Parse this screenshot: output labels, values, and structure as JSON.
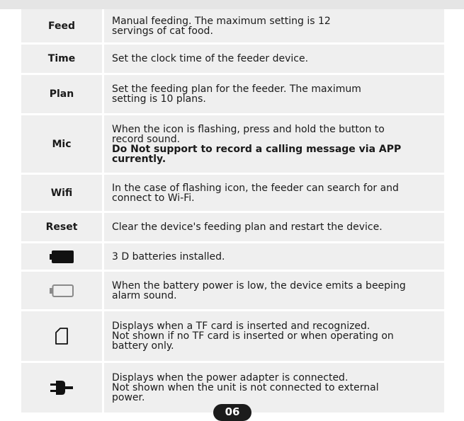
{
  "rows": [
    {
      "label": "Feed",
      "text": [
        "Manual feeding. The maximum setting is 12",
        "servings of cat food."
      ]
    },
    {
      "label": "Time",
      "text": [
        "Set the clock time of the feeder device."
      ]
    },
    {
      "label": "Plan",
      "text": [
        "Set the feeding plan for the feeder. The maximum",
        "setting is 10 plans."
      ]
    },
    {
      "label": "Mic",
      "text": [
        "When the icon is flashing, press and hold the button to",
        "record sound."
      ],
      "bold": [
        "Do Not support to record a calling message via APP",
        "currently."
      ]
    },
    {
      "label": "Wifi",
      "text": [
        "In the case of flashing icon, the feeder can search for and",
        "connect to Wi-Fi."
      ]
    },
    {
      "label": "Reset",
      "text": [
        "Clear the device's feeding plan and restart the device."
      ]
    },
    {
      "icon": "battery-full-icon",
      "text": [
        "3 D batteries installed."
      ]
    },
    {
      "icon": "battery-empty-icon",
      "text": [
        "When the battery power is low, the device emits a beeping",
        "alarm sound."
      ]
    },
    {
      "icon": "sd-card-icon",
      "text": [
        "Displays when a TF card is inserted and recognized.",
        "Not shown if no TF card is inserted or when operating on",
        "battery only."
      ]
    },
    {
      "icon": "power-plug-icon",
      "text": [
        "Displays when the power adapter is connected.",
        "Not shown when the unit is not connected to external",
        "power."
      ]
    }
  ],
  "page_number": "06"
}
